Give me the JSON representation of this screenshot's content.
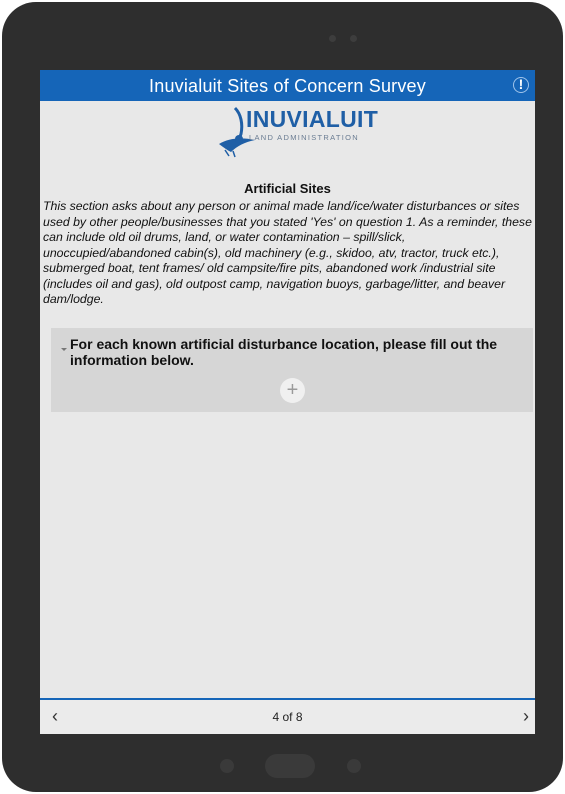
{
  "header": {
    "title": "Inuvialuit Sites of Concern Survey",
    "alert_icon": "exclamation-icon"
  },
  "logo": {
    "name": "INUVIALUIT",
    "subtitle": "LAND ADMINISTRATION",
    "icon": "owl-icon",
    "brand_color": "#1F5FA6"
  },
  "section": {
    "title": "Artificial Sites",
    "text": "This section asks about any person or animal made land/ice/water disturbances or sites used by other people/businesses that you stated 'Yes' on question 1. As a reminder, these can include old oil drums, land, or water contamination – spill/slick, unoccupied/abandoned cabin(s), old machinery (e.g., skidoo, atv, tractor, truck etc.), submerged boat, tent frames/ old campsite/fire pits, abandoned work /industrial site (includes oil and gas), old outpost camp, navigation buoys, garbage/litter, and beaver dam/lodge."
  },
  "repeat": {
    "label": "For each known artificial disturbance location, please fill out the information below.",
    "add_icon": "plus-icon",
    "collapse_icon": "chevron-down-icon"
  },
  "footer": {
    "page_indicator": "4 of 8",
    "prev_icon": "chevron-left-icon",
    "next_icon": "chevron-right-icon",
    "accent_color": "#1565B8"
  }
}
